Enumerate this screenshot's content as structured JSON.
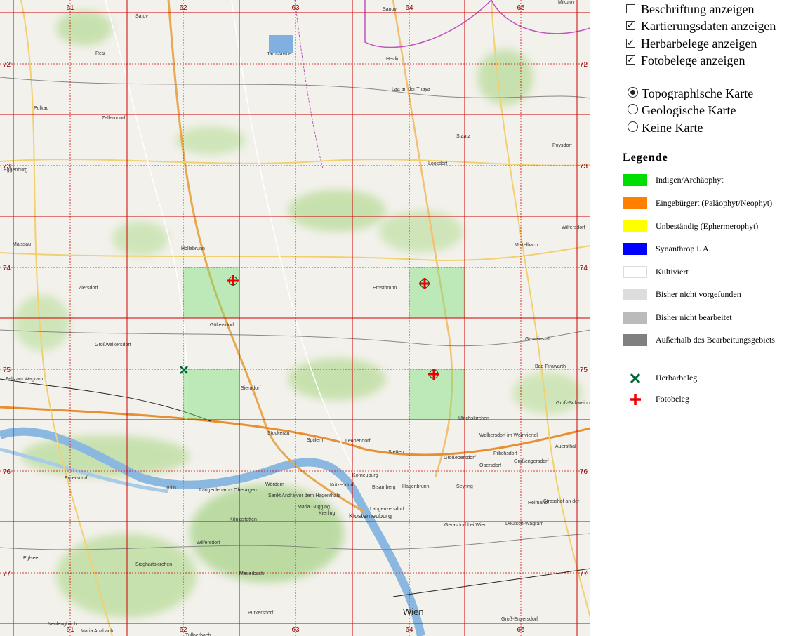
{
  "map": {
    "grid_col_labels": [
      "61",
      "62",
      "63",
      "64",
      "65"
    ],
    "grid_row_labels": [
      "72",
      "73",
      "74",
      "75",
      "76",
      "77"
    ],
    "places": [
      "Šatov",
      "Sanov",
      "Mikulov",
      "Jaroslavice",
      "Hevlin",
      "Retz",
      "Laa an der Thaya",
      "Pulkau",
      "Zellerndorf",
      "Staatz",
      "Poysdorf",
      "Eggenburg",
      "Loosdorf",
      "Wilfersdorf",
      "Maissau",
      "Hollabrunn",
      "Mistelbach",
      "Ziersdorf",
      "Ernstbrunn",
      "Göllersdorf",
      "Großweikersdorf",
      "Gaweinstal",
      "Bad Pirawarth",
      "Fels am Wagram",
      "Sierndorf",
      "Groß-Schweinbarth",
      "Ulrichskirchen",
      "Stockerau",
      "Spillern",
      "Leobendorf",
      "Wolkersdorf im Weinviertel",
      "Auersthal",
      "Stetten",
      "Pillichsdorf",
      "Großebersdorf",
      "Obersdorf",
      "Großengersdorf",
      "Korneuburg",
      "Erpersdorf",
      "Tulln",
      "Langenlebarn - Oberaigen",
      "Bisamberg",
      "Hagenbrunn",
      "Seyring",
      "Wördern",
      "Kritzendorf",
      "Sankt Andrä vor dem Hagenthale",
      "Langenzersdorf",
      "Helmahof",
      "Strasshof an der",
      "Maria Gugging",
      "Kierling",
      "Klosterneuburg",
      "Gerasdorf bei Wien",
      "Deutsch-Wagram",
      "Königstetten",
      "Wilfersdorf",
      "Eglsee",
      "Sieghartskirchen",
      "Mauerbach",
      "Purkersdorf",
      "Wien",
      "Groß-Enzersdorf",
      "Neulengbach",
      "Maria Anzbach",
      "Tullnerbach"
    ],
    "markers": [
      {
        "type": "Fotobeleg",
        "icon": "red-cross-icon"
      },
      {
        "type": "Fotobeleg",
        "icon": "red-cross-icon"
      },
      {
        "type": "Fotobeleg",
        "icon": "red-cross-icon"
      },
      {
        "type": "Herbarbeleg",
        "icon": "green-x-icon"
      }
    ]
  },
  "options": {
    "checkboxes": [
      {
        "label": "Beschriftung anzeigen",
        "checked": false
      },
      {
        "label": "Kartierungsdaten anzeigen",
        "checked": true
      },
      {
        "label": "Herbarbelege anzeigen",
        "checked": true
      },
      {
        "label": "Fotobelege anzeigen",
        "checked": true
      }
    ],
    "radios": [
      {
        "label": "Topographische Karte",
        "selected": true
      },
      {
        "label": "Geologische Karte",
        "selected": false
      },
      {
        "label": "Keine Karte",
        "selected": false
      }
    ]
  },
  "legend": {
    "title": "Legende",
    "items": [
      {
        "label": "Indigen/Archäophyt",
        "color": "#00dd00"
      },
      {
        "label": "Eingebürgert (Paläophyt/Neophyt)",
        "color": "#ff8000"
      },
      {
        "label": "Unbeständig (Ephermerophyt)",
        "color": "#ffff00"
      },
      {
        "label": "Synanthrop i. A.",
        "color": "#0000ff"
      },
      {
        "label": "Kultiviert",
        "color": "#ffffff"
      },
      {
        "label": "Bisher nicht vorgefunden",
        "color": "#dddddd"
      },
      {
        "label": "Bisher nicht bearbeitet",
        "color": "#bbbbbb"
      },
      {
        "label": "Außerhalb des Bearbeitungsgebiets",
        "color": "#808080"
      }
    ],
    "symbols": [
      {
        "label": "Herbarbeleg",
        "icon": "green-x-icon",
        "color": "#006633"
      },
      {
        "label": "Fotobeleg",
        "icon": "red-cross-icon",
        "color": "#ee0000"
      }
    ]
  }
}
